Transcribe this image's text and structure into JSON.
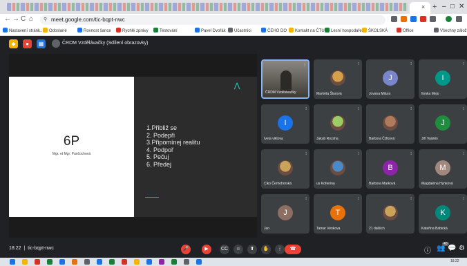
{
  "browser": {
    "tab_close": "×",
    "new_tab": "+",
    "window_controls": [
      "–",
      "□",
      "✕"
    ],
    "nav": [
      "←",
      "→",
      "C",
      "⌂"
    ],
    "url": "meet.google.com/tic-bqpt-nwc",
    "bookmarks": [
      "Nastavení stránk...",
      "Odoslané",
      "Rovnost šance",
      "Rychlé zprávy",
      "Testování",
      "Pavel Dvořák",
      "Účastníci",
      "ČEHO DO",
      "Kontakt na ČTU",
      "Lesní hospodaření",
      "ŠKOLSKÁ",
      "Office",
      "Všechny záložky"
    ],
    "bookmark_colors": [
      "#1a73e8",
      "#f4b400",
      "#1a73e8",
      "#d93025",
      "#188038",
      "#1a73e8",
      "#5f6368",
      "#1a73e8",
      "#f4b400",
      "#188038",
      "#f4b400",
      "#d93025",
      "#5f6368"
    ]
  },
  "meeting": {
    "top_title": "ČRDM Vzdělávačky (Sdílení obrazovky)",
    "code": "tic-bqpt-nwc",
    "time": "18:22"
  },
  "slide": {
    "title": "6P",
    "subtitle": "Mgr. et Mgr. Pančochová",
    "items": [
      "1.Přibliž se",
      "2. Podepři",
      "3.Připomínej realitu",
      "4. Podpoř",
      "5. Pečuj",
      "6. Předej"
    ]
  },
  "participants": [
    {
      "name": "ČRDM Vzdělávačky",
      "avatar": "",
      "color": "#5c5a55",
      "kind": "self"
    },
    {
      "name": "Markéta Šturová",
      "avatar": "",
      "color": "#3c4043",
      "kind": "photo"
    },
    {
      "name": "Jovana Milura",
      "avatar": "J",
      "color": "#7986cb",
      "kind": "letter"
    },
    {
      "name": "Ilonka Mejo",
      "avatar": "I",
      "color": "#009688",
      "kind": "letter"
    },
    {
      "name": "Ivetа viktova",
      "avatar": "I",
      "color": "#1a73e8",
      "kind": "letter"
    },
    {
      "name": "Jakub Rozsha",
      "avatar": "",
      "color": "#3c4043",
      "kind": "photo"
    },
    {
      "name": "Barbora Čížková",
      "avatar": "",
      "color": "#3c4043",
      "kind": "photo"
    },
    {
      "name": "Jiří Vaiskin",
      "avatar": "J",
      "color": "#1e8e3e",
      "kind": "letter"
    },
    {
      "name": "Ciko Čerhohorská",
      "avatar": "",
      "color": "#3c4043",
      "kind": "photo"
    },
    {
      "name": "us Kořenina",
      "avatar": "",
      "color": "#3c4043",
      "kind": "photo"
    },
    {
      "name": "Barbora Marková",
      "avatar": "B",
      "color": "#8e24aa",
      "kind": "letter"
    },
    {
      "name": "Magdaléna Hynková",
      "avatar": "M",
      "color": "#a1887f",
      "kind": "letter"
    },
    {
      "name": "Jan",
      "avatar": "J",
      "color": "#8d6e63",
      "kind": "letter"
    },
    {
      "name": "Tamar Venkova",
      "avatar": "T",
      "color": "#e8710a",
      "kind": "letter"
    },
    {
      "name": "21 dalších",
      "avatar": "",
      "color": "#3c4043",
      "kind": "group"
    },
    {
      "name": "Kateřina Babická",
      "avatar": "K",
      "color": "#00897b",
      "kind": "letter"
    }
  ],
  "controls": {
    "mic": "🎤",
    "cam": "▶",
    "cc": "CC",
    "emoji": "☺",
    "present": "⬆",
    "hand": "✋",
    "more": "⋮",
    "end": "☎",
    "info": "ⓘ",
    "people": "👥",
    "people_count": "40",
    "chat": "💬",
    "activities": "⚙"
  },
  "taskbar": {
    "tray_time": "18:22",
    "icon_colors": [
      "#1a73e8",
      "#f4b400",
      "#d93025",
      "#188038",
      "#1a73e8",
      "#e8710a",
      "#5f6368",
      "#1a73e8",
      "#188038",
      "#d93025",
      "#f4b400",
      "#1a73e8",
      "#8e24aa",
      "#188038",
      "#5f6368",
      "#1a73e8"
    ]
  }
}
